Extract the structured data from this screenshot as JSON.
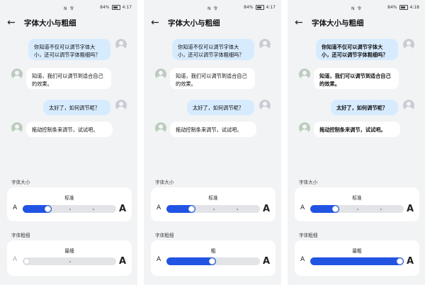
{
  "panels": [
    {
      "status": {
        "center": "N 令",
        "battery": "84%",
        "time": "4:17"
      },
      "title": "字体大小与粗细",
      "messages": [
        {
          "side": "right",
          "text": "你知道不仅可以调节字体大小，还可以调节字体粗细吗？"
        },
        {
          "side": "left",
          "text": "知道，我们可以调节到适合自己的效果。"
        },
        {
          "side": "right",
          "text": "太好了，如何调节呢？"
        },
        {
          "side": "left",
          "text": "拖动控制条来调节，试试吧。"
        }
      ],
      "size_section": {
        "label": "字体大小",
        "value_label": "标准",
        "level": 0.25
      },
      "weight_section": {
        "label": "字体粗细",
        "value_label": "最细",
        "level": 0.0
      },
      "letter_small": "A",
      "letter_big": "A"
    },
    {
      "status": {
        "center": "N 令",
        "battery": "84%",
        "time": "4:17"
      },
      "title": "字体大小与粗细",
      "messages": [
        {
          "side": "right",
          "text": "你知道不仅可以调节字体大小，还可以调节字体粗细吗？"
        },
        {
          "side": "left",
          "text": "知道，我们可以调节到适合自己的效果。"
        },
        {
          "side": "right",
          "text": "太好了，如何调节呢？"
        },
        {
          "side": "left",
          "text": "拖动控制条来调节，试试吧。"
        }
      ],
      "size_section": {
        "label": "字体大小",
        "value_label": "标准",
        "level": 0.25
      },
      "weight_section": {
        "label": "字体粗细",
        "value_label": "粗",
        "level": 0.45
      },
      "letter_small": "A",
      "letter_big": "A"
    },
    {
      "status": {
        "center": "N 令",
        "battery": "84%",
        "time": "4:18"
      },
      "title": "字体大小与粗细",
      "messages": [
        {
          "side": "right",
          "text": "你知道不仅可以调节字体大小，还可以调节字体粗细吗？"
        },
        {
          "side": "left",
          "text": "知道，我们可以调节到适合自己的效果。"
        },
        {
          "side": "right",
          "text": "太好了，如何调节呢？"
        },
        {
          "side": "left",
          "text": "拖动控制条来调节，试试吧。"
        }
      ],
      "size_section": {
        "label": "字体大小",
        "value_label": "标准",
        "level": 0.25
      },
      "weight_section": {
        "label": "字体粗细",
        "value_label": "最粗",
        "level": 1.0
      },
      "letter_small": "A",
      "letter_big": "A"
    }
  ],
  "colors": {
    "accent": "#2154e3",
    "background": "#f1f3f5",
    "bubble_user": "#d7ebff",
    "bubble_reply": "#ffffff"
  }
}
